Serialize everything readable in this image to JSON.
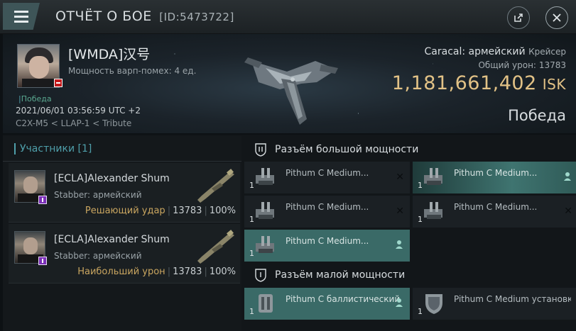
{
  "window": {
    "title": "ОТЧЁТ О БОЕ",
    "report_id": "[ID:5473722]",
    "menu_icon": "hamburger-menu-icon",
    "share_icon": "share-icon",
    "close_icon": "close-icon"
  },
  "victim": {
    "name": "[WMDA]汉号",
    "subtitle": "Мощность варп-помех: 4 ед.",
    "result_small": "Победа",
    "date": "2021/06/01 03:56:59 UTC +2",
    "location": "C2X-M5 < LLAP-1 < Tribute",
    "ship_name": "Caracal: армейский",
    "ship_class": "Крейсер",
    "damage_label": "Общий урон:",
    "damage_value": "13783",
    "isk_value": "1,181,661,402",
    "isk_unit": "ISK",
    "outcome": "Победа"
  },
  "participants": {
    "header": "Участники [1]",
    "items": [
      {
        "name": "[ECLA]Alexander Shum",
        "ship": "Stabber: армейский",
        "role": "Решающий удар",
        "damage": "13783",
        "percent": "100%"
      },
      {
        "name": "[ECLA]Alexander Shum",
        "ship": "Stabber: армейский",
        "role": "Наибольший урон",
        "damage": "13783",
        "percent": "100%"
      }
    ]
  },
  "fitting": {
    "high_slot_label": "Разъём большой мощности",
    "low_slot_label": "Разъём малой мощности",
    "high_modules": [
      {
        "name": "Pithum C Medium...",
        "qty": "1",
        "state": "destroyed"
      },
      {
        "name": "Pithum C Medium...",
        "qty": "1",
        "state": "dropped"
      },
      {
        "name": "Pithum C Medium...",
        "qty": "1",
        "state": "destroyed"
      },
      {
        "name": "Pithum C Medium...",
        "qty": "1",
        "state": "destroyed"
      },
      {
        "name": "Pithum C Medium...",
        "qty": "1",
        "state": "dropped"
      }
    ],
    "low_modules": [
      {
        "name": "Pithum C баллистический",
        "qty": "1",
        "state": "dropped"
      },
      {
        "name": "Pithum C Medium установк...",
        "qty": "1",
        "state": "destroyed"
      }
    ]
  },
  "colors": {
    "accent_teal": "#4f9faa",
    "isk_gold": "#e2c286",
    "role_gold": "#caa660",
    "dropped_bg": "#3a6a67",
    "destroyed_flag": "#c4191b",
    "alpha_badge": "#7b2fb8"
  }
}
